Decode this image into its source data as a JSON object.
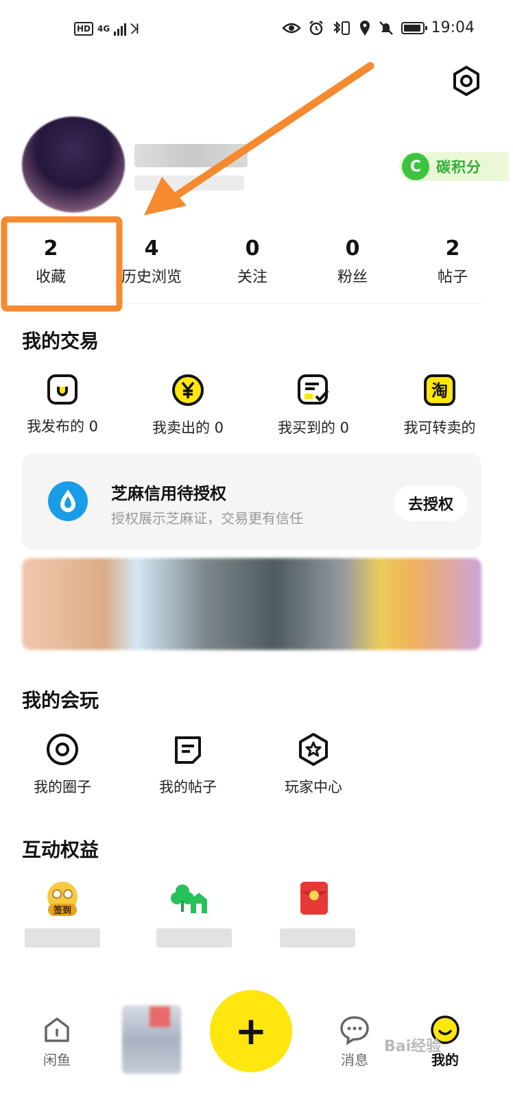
{
  "status_bar": {
    "left_badge": "HD",
    "net": "4G",
    "time": "19:04"
  },
  "profile": {
    "carbon_badge_letter": "C",
    "carbon_label": "碳积分"
  },
  "stats": [
    {
      "value": "2",
      "label": "收藏"
    },
    {
      "value": "4",
      "label": "历史浏览"
    },
    {
      "value": "0",
      "label": "关注"
    },
    {
      "value": "0",
      "label": "粉丝"
    },
    {
      "value": "2",
      "label": "帖子"
    }
  ],
  "trade": {
    "title": "我的交易",
    "items": [
      {
        "label": "我发布的 0",
        "icon": "bag-icon"
      },
      {
        "label": "我卖出的 0",
        "icon": "yuan-coin-icon"
      },
      {
        "label": "我买到的 0",
        "icon": "receipt-check-icon"
      },
      {
        "label": "我可转卖的",
        "icon": "tao-icon"
      }
    ]
  },
  "sesame": {
    "title": "芝麻信用待授权",
    "subtitle": "授权展示芝麻证，交易更有信任",
    "button": "去授权"
  },
  "play": {
    "title": "我的会玩",
    "items": [
      {
        "label": "我的圈子",
        "icon": "circle-target-icon"
      },
      {
        "label": "我的帖子",
        "icon": "post-note-icon"
      },
      {
        "label": "玩家中心",
        "icon": "star-hexagon-icon"
      }
    ]
  },
  "rewards": {
    "title": "互动权益",
    "checkin_label": "签到"
  },
  "bottom_nav": {
    "home": "闲鱼",
    "messages": "消息",
    "mine": "我的",
    "plus": "+"
  },
  "watermark": "Bai经验",
  "colors": {
    "accent_yellow": "#ffe60f",
    "highlight_orange": "#f58a2f",
    "carbon_green": "#3dc43f",
    "sesame_blue": "#1a9ce8"
  }
}
